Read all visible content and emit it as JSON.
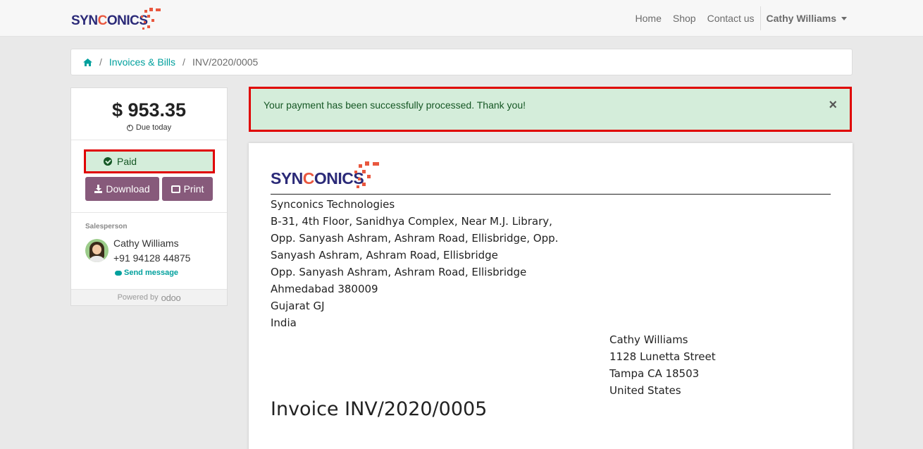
{
  "brand": {
    "logo_text_pre": "SYN",
    "logo_text_c": "C",
    "logo_text_post": "ONICS"
  },
  "nav": {
    "links": [
      "Home",
      "Shop",
      "Contact us"
    ],
    "user": "Cathy Williams"
  },
  "breadcrumb": {
    "sep": "/",
    "link": "Invoices & Bills",
    "current": "INV/2020/0005"
  },
  "summary": {
    "amount": "$ 953.35",
    "due": "Due today",
    "status": "Paid",
    "download_label": "Download",
    "print_label": "Print"
  },
  "salesperson": {
    "label": "Salesperson",
    "name": "Cathy Williams",
    "phone": "+91 94128 44875",
    "message_label": "Send message"
  },
  "powered": {
    "label": "Powered by",
    "brand": "odoo"
  },
  "alert": {
    "text": "Your payment has been successfully processed. Thank you!",
    "close": "×"
  },
  "invoice": {
    "company_lines": [
      "Synconics Technologies",
      "B-31, 4th Floor, Sanidhya Complex, Near M.J. Library,",
      "Opp. Sanyash Ashram, Ashram Road, Ellisbridge, Opp.",
      "Sanyash Ashram, Ashram Road, Ellisbridge",
      "Opp. Sanyash Ashram, Ashram Road, Ellisbridge",
      "Ahmedabad 380009",
      "Gujarat GJ",
      "India"
    ],
    "customer_lines": [
      "Cathy Williams",
      "1128 Lunetta Street",
      "Tampa CA 18503",
      "United States"
    ],
    "title": "Invoice INV/2020/0005"
  },
  "colors": {
    "accent": "#00a09d",
    "button": "#875a7b",
    "brand_navy": "#2b2a78",
    "brand_orange": "#e9573e",
    "success_bg": "#d4edda",
    "highlight_border": "#e00000"
  }
}
